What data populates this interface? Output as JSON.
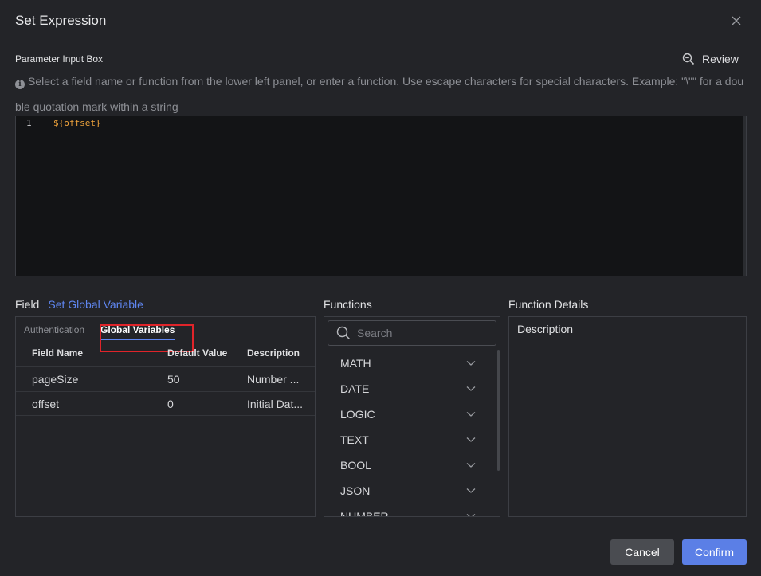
{
  "dialog": {
    "title": "Set Expression",
    "close_icon": "close-icon"
  },
  "param_box": {
    "label": "Parameter Input Box",
    "review_label": "Review",
    "review_icon": "zoom-search-icon",
    "hint": "Select a field name or function from the lower left panel, or enter a function. Use escape characters for special characters. Example: \"\\\"\" for a double quotation mark within a string",
    "info_icon": "info-icon"
  },
  "editor": {
    "line_number": "1",
    "code": "${offset}"
  },
  "field_pane": {
    "title": "Field",
    "set_global_link": "Set Global Variable",
    "tabs": [
      {
        "label": "Authentication",
        "active": false
      },
      {
        "label": "Global Variables",
        "active": true
      }
    ],
    "columns": [
      "Field Name",
      "Default Value",
      "Description"
    ],
    "rows": [
      {
        "name": "pageSize",
        "default": "50",
        "description": "Number ..."
      },
      {
        "name": "offset",
        "default": "0",
        "description": "Initial Dat..."
      }
    ]
  },
  "functions_pane": {
    "title": "Functions",
    "search_placeholder": "Search",
    "items": [
      "MATH",
      "DATE",
      "LOGIC",
      "TEXT",
      "BOOL",
      "JSON",
      "NUMBER"
    ]
  },
  "details_pane": {
    "title": "Function Details",
    "header": "Description"
  },
  "footer": {
    "cancel_label": "Cancel",
    "confirm_label": "Confirm"
  },
  "colors": {
    "background": "#232428",
    "accent": "#5b7fe6",
    "link": "#5f86f0",
    "code": "#f0a43c",
    "highlight_border": "#e0242a"
  }
}
